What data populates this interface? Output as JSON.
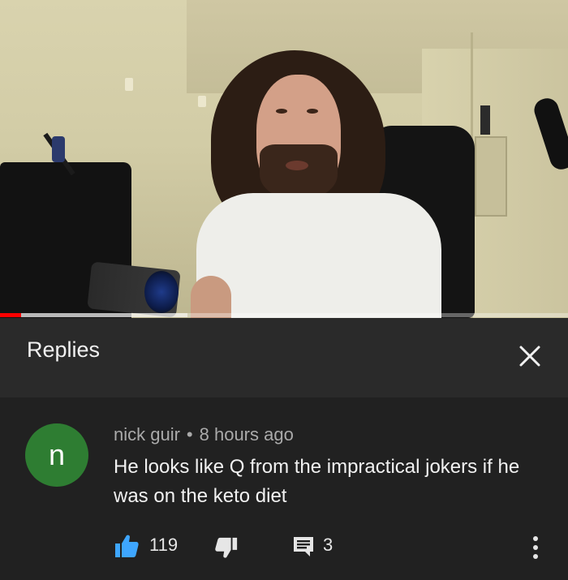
{
  "video": {
    "progress_played_fraction": 0.037,
    "progress_buffered_fraction": 0.33
  },
  "header": {
    "title": "Replies",
    "close_icon": "close-icon"
  },
  "comment": {
    "avatar_letter": "n",
    "avatar_color": "#2e7d32",
    "author": "nick guir",
    "separator": "•",
    "timestamp": "8 hours ago",
    "text": "He looks like Q from the impractical jokers if he was on the keto diet",
    "like_count": "119",
    "reply_count": "3",
    "like_color": "#3ea6ff"
  },
  "icons": [
    "thumbs-up-icon",
    "thumbs-down-icon",
    "reply-icon",
    "more-vert-icon",
    "close-icon"
  ],
  "colors": {
    "background": "#212121",
    "header_background": "#2a2a2a",
    "progress_red": "#ff0000"
  }
}
